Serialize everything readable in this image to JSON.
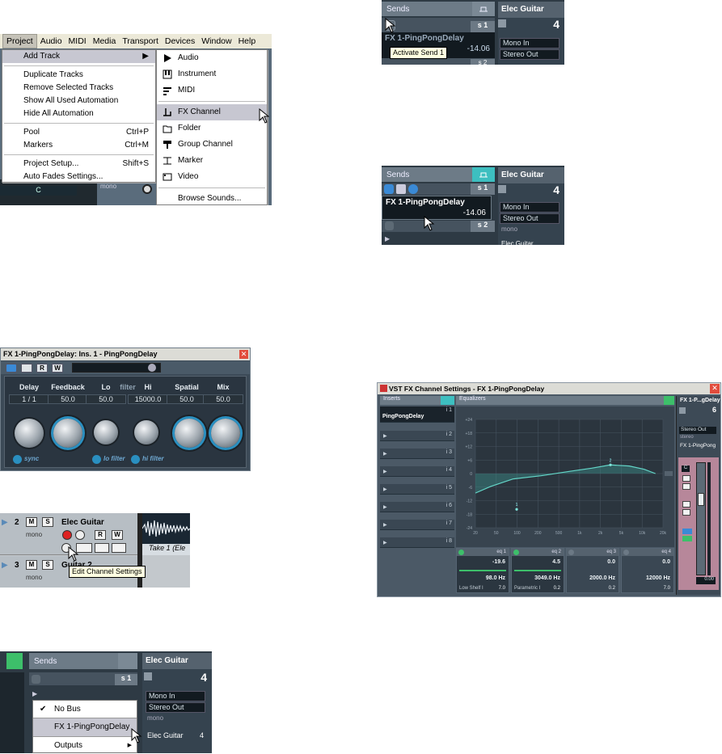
{
  "menu_panel": {
    "menubar": [
      "Project",
      "Audio",
      "MIDI",
      "Media",
      "Transport",
      "Devices",
      "Window",
      "Help"
    ],
    "project_menu": [
      {
        "label": "Add Track",
        "shortcut": "",
        "arrow": "▶",
        "highlight": true
      },
      {
        "sep": true
      },
      {
        "label": "Duplicate Tracks",
        "shortcut": ""
      },
      {
        "label": "Remove Selected Tracks",
        "shortcut": ""
      },
      {
        "label": "Show All Used Automation",
        "shortcut": ""
      },
      {
        "label": "Hide All Automation",
        "shortcut": ""
      },
      {
        "sep": true
      },
      {
        "label": "Pool",
        "shortcut": "Ctrl+P"
      },
      {
        "label": "Markers",
        "shortcut": "Ctrl+M"
      },
      {
        "sep": true
      },
      {
        "label": "Project Setup...",
        "shortcut": "Shift+S"
      },
      {
        "label": "Auto Fades Settings...",
        "shortcut": ""
      }
    ],
    "add_track_menu": [
      {
        "label": "Audio",
        "icon": "play-icon"
      },
      {
        "label": "Instrument",
        "icon": "instrument-icon"
      },
      {
        "label": "MIDI",
        "icon": "midi-icon"
      },
      {
        "sep": true
      },
      {
        "label": "FX Channel",
        "icon": "fx-channel-icon",
        "highlight": true
      },
      {
        "label": "Folder",
        "icon": "folder-icon"
      },
      {
        "label": "Group Channel",
        "icon": "group-channel-icon"
      },
      {
        "label": "Marker",
        "icon": "marker-icon"
      },
      {
        "label": "Video",
        "icon": "video-icon"
      },
      {
        "sep": true
      },
      {
        "label": "Browse Sounds...",
        "icon": ""
      }
    ],
    "bg_pan": "C",
    "bg_mono": "mono"
  },
  "sends_top": {
    "header": "Sends",
    "slot1": "s 1",
    "slot2": "s 2",
    "fx_name": "FX 1-PingPongDelay",
    "fx_value": "-14.06",
    "tooltip": "Activate Send 1",
    "track_name": "Elec Guitar",
    "track_num": "4",
    "in": "Mono In",
    "out": "Stereo Out"
  },
  "sends_mid": {
    "header": "Sends",
    "slot1": "s 1",
    "slot2": "s 2",
    "fx_name": "FX 1-PingPongDelay",
    "fx_value": "-14.06",
    "track_name": "Elec Guitar",
    "track_num": "4",
    "in": "Mono In",
    "out": "Stereo Out",
    "mono": "mono",
    "extra": "Elec Guitar"
  },
  "plugin": {
    "title": "FX 1-PingPongDelay: Ins. 1 - PingPongDelay",
    "btns": [
      "R",
      "W"
    ],
    "labels": [
      "Delay",
      "Feedback",
      "Lo",
      "filter",
      "Hi",
      "Spatial",
      "Mix"
    ],
    "values": [
      "1 / 1",
      "50.0",
      "50.0",
      "15000.0",
      "50.0",
      "50.0"
    ],
    "sync": "sync",
    "lofilter": "lo filter",
    "hifilter": "hi filter",
    "levels": [
      0.5,
      0.5,
      0.5,
      0.5,
      0.5,
      0.5
    ]
  },
  "tracks": {
    "t2_num": "2",
    "t2_name": "Elec Guitar",
    "t2_mono": "mono",
    "t3_num": "3",
    "t3_name": "Guitar 2",
    "t3_mono": "mono",
    "take": "Take 1 (Ele",
    "tooltip": "Edit Channel Settings",
    "m": "M",
    "s": "S",
    "r": "R",
    "w": "W"
  },
  "sends_bottom": {
    "header": "Sends",
    "slot1": "s 1",
    "track_name": "Elec Guitar",
    "track_num": "4",
    "in": "Mono In",
    "out": "Stereo Out",
    "mono": "mono",
    "extra": "Elec Guitar",
    "extra_num": "4",
    "popup": [
      {
        "label": "No Bus",
        "check": "✔"
      },
      {
        "label": "FX 1-PingPongDelay"
      },
      {
        "label": "Outputs",
        "arrow": "▶"
      }
    ]
  },
  "eq_window": {
    "title": "VST FX Channel Settings - FX 1-PingPongDelay",
    "inserts": "Inserts",
    "equalizers": "Equalizers",
    "slot1": "PingPongDelay",
    "slots": [
      "i 1",
      "i 2",
      "i 3",
      "i 4",
      "i 5",
      "i 6",
      "i 7",
      "i 8"
    ],
    "y_ticks": [
      "+24",
      "+18",
      "+12",
      "+6",
      "0",
      "-6",
      "-12",
      "-18",
      "-24"
    ],
    "x_ticks": [
      "20",
      "50",
      "100",
      "200",
      "500",
      "1k",
      "2k",
      "5k",
      "10k",
      "20k"
    ],
    "bands": [
      {
        "name": "eq 1",
        "gain": "-19.6",
        "freq": "98.0 Hz",
        "type": "Low Shelf I",
        "q": "7.0"
      },
      {
        "name": "eq 2",
        "gain": "4.5",
        "freq": "3049.0 Hz",
        "type": "Parametric I",
        "q": "0.2"
      },
      {
        "name": "eq 3",
        "gain": "0.0",
        "freq": "2000.0 Hz",
        "type": "",
        "q": "0.2"
      },
      {
        "name": "eq 4",
        "gain": "0.0",
        "freq": "12000 Hz",
        "type": "",
        "q": "7.0"
      }
    ],
    "ch_name": "FX 1-P...gDelay",
    "ch_num": "6",
    "out": "Stereo Out",
    "stereo": "stereo",
    "ch_full": "FX 1-PingPong",
    "pan": "C",
    "fader_val": "0.00"
  }
}
